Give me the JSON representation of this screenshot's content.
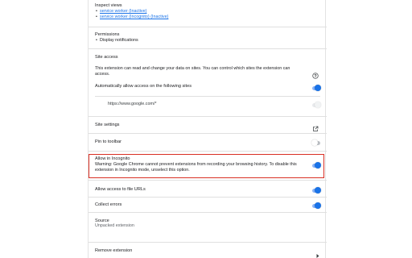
{
  "inspect_views": {
    "heading": "Inspect views",
    "links": [
      "service worker (Inactive)",
      "service worker (Incognito) (Inactive)"
    ]
  },
  "permissions": {
    "heading": "Permissions",
    "items": [
      "Display notifications"
    ]
  },
  "site_access": {
    "heading": "Site access",
    "description": "This extension can read and change your data on sites. You can control which sites the extension can access.",
    "auto_allow_label": "Automatically allow access on the following sites",
    "auto_allow_on": true,
    "site_url": "https://www.google.com/*"
  },
  "site_settings": {
    "label": "Site settings"
  },
  "pin_toolbar": {
    "label": "Pin to toolbar",
    "on": false
  },
  "incognito": {
    "label": "Allow in Incognito",
    "warning": "Warning: Google Chrome cannot prevent extensions from recording your browsing history. To disable this extension in Incognito mode, unselect this option.",
    "on": true
  },
  "file_urls": {
    "label": "Allow access to file URLs",
    "on": true
  },
  "collect_errors": {
    "label": "Collect errors",
    "on": true
  },
  "source": {
    "heading": "Source",
    "value": "Unpacked extension"
  },
  "remove": {
    "label": "Remove extension"
  },
  "colors": {
    "accent": "#1a73e8",
    "highlight": "#d93025",
    "link": "#1a73e8"
  },
  "icons": {
    "help": "help-circle-icon",
    "open": "open-in-new-icon",
    "chevron": "chevron-right-icon"
  }
}
